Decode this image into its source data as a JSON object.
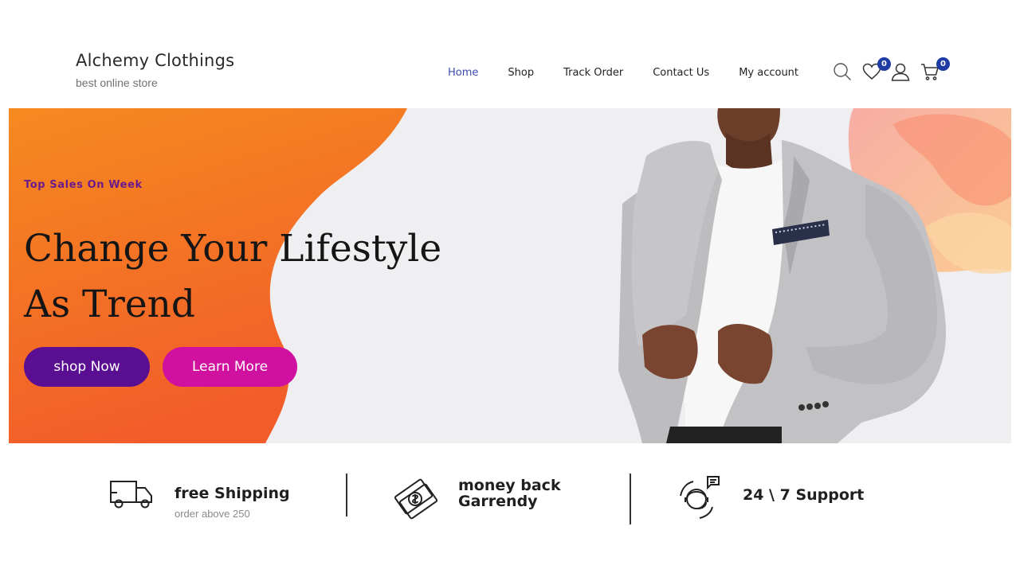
{
  "header": {
    "brand_title": "Alchemy Clothings",
    "brand_tagline": "best online store",
    "nav": [
      {
        "label": "Home",
        "active": true
      },
      {
        "label": "Shop",
        "active": false
      },
      {
        "label": "Track Order",
        "active": false
      },
      {
        "label": "Contact Us",
        "active": false
      },
      {
        "label": "My account",
        "active": false
      }
    ],
    "icons": {
      "search": "search-icon",
      "wishlist": "heart-icon",
      "account": "user-icon",
      "cart": "cart-icon"
    },
    "wishlist_count": "0",
    "cart_count": "0"
  },
  "hero": {
    "kicker": "Top Sales On Week",
    "title_line1": "Change Your Lifestyle",
    "title_line2": "As Trend",
    "primary_button": "shop Now",
    "secondary_button": "Learn More"
  },
  "features": [
    {
      "title": "free Shipping",
      "subtitle": "order above 250",
      "icon": "truck-icon"
    },
    {
      "title_line1": "money back",
      "title_line2": "Garrendy",
      "icon": "money-icon"
    },
    {
      "title": "24 \\ 7 Support",
      "icon": "support-icon"
    }
  ],
  "colors": {
    "accent_blue": "#1e3ba6",
    "nav_active": "#3b4cb0",
    "hero_orange": "#f47d20",
    "btn_purple": "#5a0f93",
    "btn_pink": "#d0109f"
  }
}
